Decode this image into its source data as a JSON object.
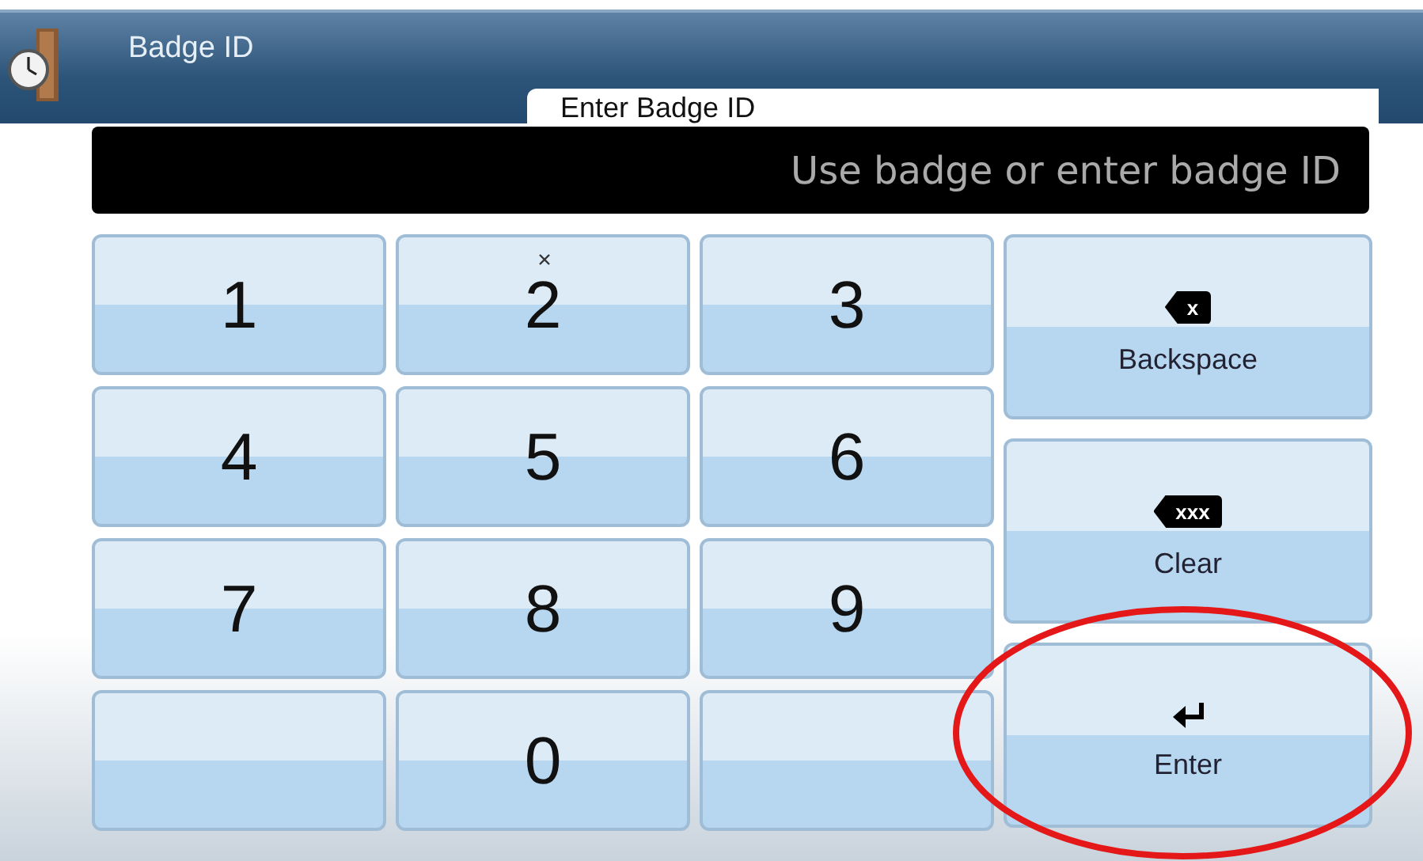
{
  "header": {
    "title": "Badge ID",
    "tab": "Enter Badge ID"
  },
  "field": {
    "placeholder": "Use badge or enter badge ID"
  },
  "keys": [
    {
      "kind": "digit",
      "label": "1"
    },
    {
      "kind": "digit",
      "label": "2"
    },
    {
      "kind": "digit",
      "label": "3"
    },
    {
      "kind": "digit",
      "label": "4"
    },
    {
      "kind": "digit",
      "label": "5"
    },
    {
      "kind": "digit",
      "label": "6"
    },
    {
      "kind": "digit",
      "label": "7"
    },
    {
      "kind": "digit",
      "label": "8"
    },
    {
      "kind": "digit",
      "label": "9"
    },
    {
      "kind": "blank"
    },
    {
      "kind": "digit",
      "label": "0"
    },
    {
      "kind": "blank"
    }
  ],
  "actions": [
    {
      "kind": "backspace",
      "label": "Backspace",
      "icon_text": "x"
    },
    {
      "kind": "clear",
      "label": "Clear",
      "icon_text": "xxx"
    },
    {
      "kind": "enter",
      "label": "Enter"
    }
  ]
}
